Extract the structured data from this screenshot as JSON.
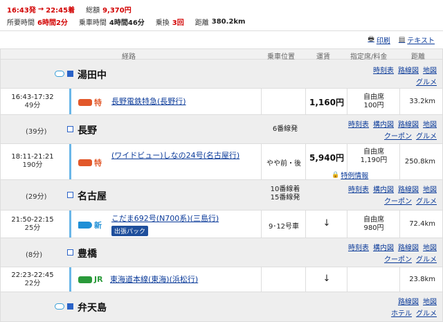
{
  "summary": {
    "dep_time": "16:43発",
    "arrow": "→",
    "arr_time": "22:45着",
    "total_label": "総額",
    "total_value": "9,370円",
    "duration_label": "所要時間",
    "duration_value": "6時間2分",
    "ride_label": "乗車時間",
    "ride_value": "4時間46分",
    "transfer_label": "乗換",
    "transfer_value": "3回",
    "distance_label": "距離",
    "distance_value": "380.2km"
  },
  "toolbar": {
    "print": "印刷",
    "text": "テキスト"
  },
  "columns": {
    "route": "経路",
    "boarding": "乗車位置",
    "fare": "運賃",
    "seat": "指定席/料金",
    "distance": "距離"
  },
  "colors": {
    "accent_red": "#d20000",
    "link_blue": "#0a3a99",
    "rail_blue": "#6ab6e8",
    "limited_express": "#e2582a",
    "shinkansen": "#1f8fd6",
    "jr_green": "#2a9a3a"
  },
  "stations": [
    {
      "name": "湯田中",
      "wait": "",
      "platform": "",
      "links_row1": [
        "時刻表",
        "路線図",
        "地図"
      ],
      "links_row2": [
        "グルメ"
      ]
    },
    {
      "name": "長野",
      "wait": "(39分)",
      "platform": "6番線発",
      "links_row1": [
        "時刻表",
        "構内図",
        "路線図",
        "地図"
      ],
      "links_row2": [
        "クーポン",
        "グルメ"
      ]
    },
    {
      "name": "名古屋",
      "wait": "(29分)",
      "platform": "10番線着\n15番線発",
      "links_row1": [
        "時刻表",
        "構内図",
        "路線図",
        "地図"
      ],
      "links_row2": [
        "クーポン",
        "グルメ"
      ]
    },
    {
      "name": "豊橋",
      "wait": "(8分)",
      "platform": "",
      "links_row1": [
        "時刻表",
        "構内図",
        "路線図",
        "地図"
      ],
      "links_row2": [
        "クーポン",
        "グルメ"
      ]
    },
    {
      "name": "弁天島",
      "wait": "",
      "platform": "",
      "links_row1": [
        "路線図",
        "地図"
      ],
      "links_row2": [
        "ホテル",
        "グルメ"
      ]
    }
  ],
  "segments": [
    {
      "time": "16:43-17:32",
      "dur": "49分",
      "type_label": "特",
      "type_icon": "limited-express-icon",
      "name": "長野電鉄特急(長野行)",
      "position": "",
      "fare": "1,160円",
      "seat_type": "自由席",
      "seat_fee": "100円",
      "distance": "33.2km",
      "extra": ""
    },
    {
      "time": "18:11-21:21",
      "dur": "190分",
      "type_label": "特",
      "type_icon": "limited-express-icon",
      "name": "(ワイドビュー)しなの24号(名古屋行)",
      "position": "やや前・後",
      "fare": "5,940円",
      "seat_type": "自由席",
      "seat_fee": "1,190円",
      "distance": "250.8km",
      "extra": "特例情報"
    },
    {
      "time": "21:50-22:15",
      "dur": "25分",
      "type_label": "新",
      "type_icon": "shinkansen-icon",
      "name": "こだま692号(N700系)(三島行)",
      "position": "9･12号車",
      "fare": "↓",
      "seat_type": "自由席",
      "seat_fee": "980円",
      "distance": "72.4km",
      "extra": "出張パック"
    },
    {
      "time": "22:23-22:45",
      "dur": "22分",
      "type_label": "JR",
      "type_icon": "jr-train-icon",
      "name": "東海道本線(東海)(浜松行)",
      "position": "",
      "fare": "↓",
      "seat_type": "",
      "seat_fee": "",
      "distance": "23.8km",
      "extra": ""
    }
  ]
}
